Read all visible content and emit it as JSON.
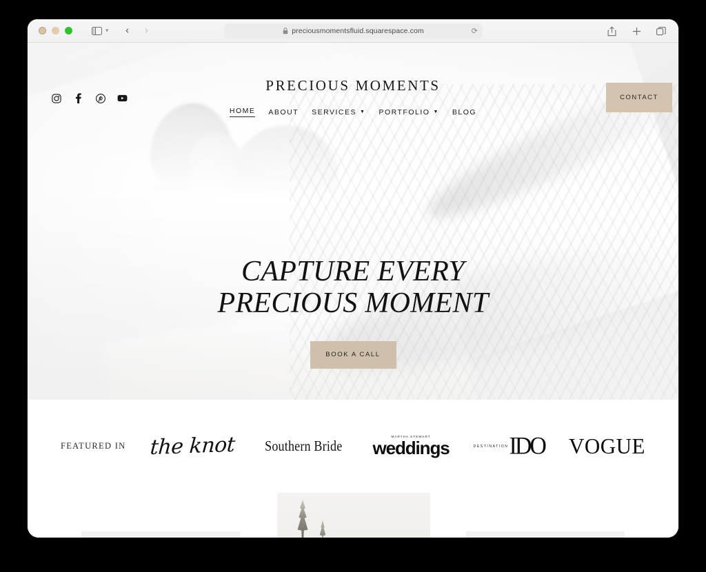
{
  "browser": {
    "url": "preciousmomentsfluid.squarespace.com",
    "lock_icon": "lock-icon",
    "reload_icon": "reload-icon",
    "sidebar_icon": "sidebar-toggle-icon",
    "dropdown_icon": "chevron-down-icon",
    "back_icon": "chevron-left-icon",
    "forward_icon": "chevron-right-icon",
    "share_icon": "share-icon",
    "new_tab_icon": "plus-icon",
    "tabs_icon": "tab-overview-icon",
    "traffic_lights": {
      "close": "#dcc3a4",
      "minimize": "#e3cbac",
      "maximize": "#2fc32f"
    }
  },
  "site": {
    "title": "PRECIOUS MOMENTS",
    "social": [
      {
        "name": "instagram-icon",
        "label": "Instagram"
      },
      {
        "name": "facebook-icon",
        "label": "Facebook"
      },
      {
        "name": "pinterest-icon",
        "label": "Pinterest"
      },
      {
        "name": "youtube-icon",
        "label": "YouTube"
      }
    ],
    "nav": [
      {
        "label": "HOME",
        "active": true,
        "has_dropdown": false
      },
      {
        "label": "ABOUT",
        "active": false,
        "has_dropdown": false
      },
      {
        "label": "SERVICES",
        "active": false,
        "has_dropdown": true
      },
      {
        "label": "PORTFOLIO",
        "active": false,
        "has_dropdown": true
      },
      {
        "label": "BLOG",
        "active": false,
        "has_dropdown": false
      }
    ],
    "contact_label": "CONTACT",
    "accent_color": "#d4c4af"
  },
  "hero": {
    "headline": "CAPTURE EVERY\nPRECIOUS MOMENT",
    "cta_label": "BOOK A CALL",
    "cta_color": "#cfc0ab",
    "image_alt": "Black and white photo of a couple kissing behind a flowing bridal veil"
  },
  "featured": {
    "label": "FEATURED IN",
    "logos": [
      {
        "name": "the-knot-logo",
        "text": "the knot"
      },
      {
        "name": "southern-bride-logo",
        "text": "Southern Bride"
      },
      {
        "name": "martha-stewart-weddings-logo",
        "eyebrow": "MARTHA STEWART",
        "text": "weddings"
      },
      {
        "name": "destination-i-do-logo",
        "eyebrow": "DESTINATION",
        "text": "IDO"
      },
      {
        "name": "vogue-logo",
        "text": "VOGUE"
      }
    ]
  },
  "gallery": {
    "image_alt": "Pale photo with evergreen trees"
  }
}
